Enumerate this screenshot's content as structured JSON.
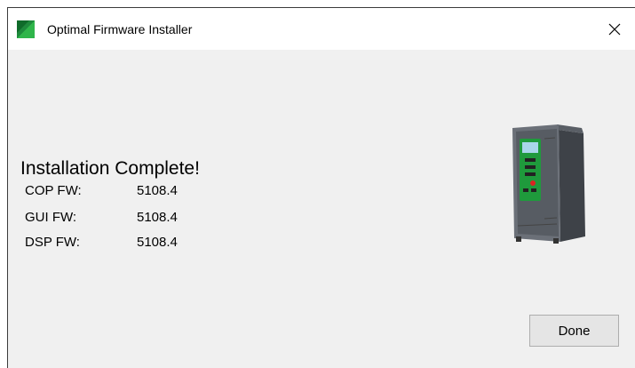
{
  "window": {
    "title": "Optimal Firmware Installer",
    "app_icon": "green-triangle-logo-icon",
    "close_icon": "close-icon"
  },
  "main": {
    "heading": "Installation Complete!",
    "firmware": [
      {
        "label": "COP FW:",
        "value": "5108.4"
      },
      {
        "label": "GUI FW:",
        "value": "5108.4"
      },
      {
        "label": "DSP FW:",
        "value": "5108.4"
      }
    ],
    "device_image": "drive-device-illustration"
  },
  "footer": {
    "done_label": "Done"
  },
  "colors": {
    "titlebar_bg": "#ffffff",
    "window_bg": "#f0f0f0",
    "logo_green": "#1e8a3c",
    "button_bg": "#e5e5e5"
  }
}
